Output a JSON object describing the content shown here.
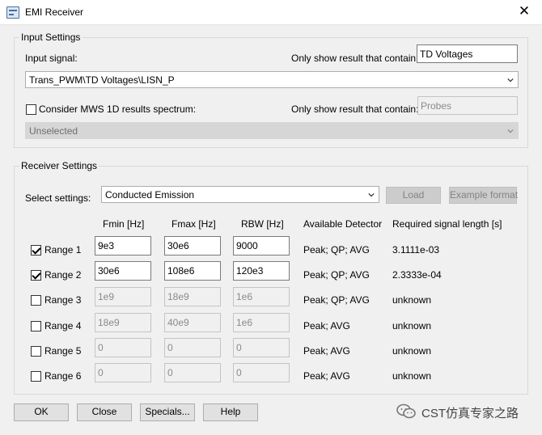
{
  "window": {
    "title": "EMI Receiver",
    "close_glyph": "✕"
  },
  "input_settings": {
    "legend": "Input Settings",
    "input_signal_label": "Input signal:",
    "filter_label": "Only show result that contain:",
    "filter_value": "TD Voltages",
    "input_signal_value": "Trans_PWM\\TD Voltages\\LISN_P",
    "consider_mws_label": "Consider MWS 1D results spectrum:",
    "consider_mws_checked": false,
    "filter2_label": "Only show result that contain:",
    "filter2_value": "Probes",
    "spectrum_value": "Unselected"
  },
  "receiver_settings": {
    "legend": "Receiver Settings",
    "select_label": "Select settings:",
    "select_value": "Conducted Emission",
    "load_label": "Load",
    "example_label": "Example format",
    "headers": {
      "fmin": "Fmin [Hz]",
      "fmax": "Fmax [Hz]",
      "rbw": "RBW [Hz]",
      "detector": "Available Detector",
      "length": "Required signal length [s]"
    },
    "ranges": [
      {
        "label": "Range 1",
        "checked": true,
        "fmin": "9e3",
        "fmax": "30e6",
        "rbw": "9000",
        "detector": "Peak; QP; AVG",
        "length": "3.1111e-03"
      },
      {
        "label": "Range 2",
        "checked": true,
        "fmin": "30e6",
        "fmax": "108e6",
        "rbw": "120e3",
        "detector": "Peak; QP; AVG",
        "length": "2.3333e-04"
      },
      {
        "label": "Range 3",
        "checked": false,
        "fmin": "1e9",
        "fmax": "18e9",
        "rbw": "1e6",
        "detector": "Peak; QP; AVG",
        "length": "unknown"
      },
      {
        "label": "Range 4",
        "checked": false,
        "fmin": "18e9",
        "fmax": "40e9",
        "rbw": "1e6",
        "detector": "Peak; AVG",
        "length": "unknown"
      },
      {
        "label": "Range 5",
        "checked": false,
        "fmin": "0",
        "fmax": "0",
        "rbw": "0",
        "detector": "Peak; AVG",
        "length": "unknown"
      },
      {
        "label": "Range 6",
        "checked": false,
        "fmin": "0",
        "fmax": "0",
        "rbw": "0",
        "detector": "Peak; AVG",
        "length": "unknown"
      }
    ]
  },
  "footer": {
    "ok_label": "OK",
    "close_label": "Close",
    "specials_label": "Specials...",
    "help_label": "Help"
  },
  "watermark": {
    "text": "CST仿真专家之路"
  },
  "icons": {
    "app": "emi-receiver-app-icon",
    "dropdown": "chevron-down-icon",
    "watermark": "wechat-logo-icon"
  },
  "colors": {
    "window_bg": "#f0f0f0",
    "title_bg": "#ffffff",
    "disabled_field": "#d6d6d6",
    "disabled_button": "#cccccc"
  }
}
